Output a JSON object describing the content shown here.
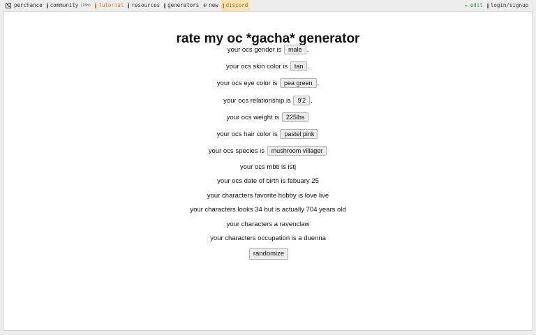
{
  "nav": {
    "brand": "perchance",
    "community": "community",
    "community_badge": "(10h)",
    "tutorial": "tutorial",
    "resources": "resources",
    "generators": "generators",
    "new": "new",
    "discord": "discord",
    "edit": "edit",
    "login": "login/signup"
  },
  "page": {
    "title": "rate my oc *gacha* generator",
    "rows": [
      {
        "prefix": "your ocs gender is",
        "value": "male",
        "suffix": "."
      },
      {
        "prefix": "your ocs skin color is",
        "value": "tan",
        "suffix": "."
      },
      {
        "prefix": "your ocs eye color is",
        "value": "pea green",
        "suffix": "."
      },
      {
        "prefix": "your ocs relationship is",
        "value": "9'2",
        "suffix": "."
      },
      {
        "prefix": "your ocs weight is",
        "value": "225lbs",
        "suffix": ""
      },
      {
        "prefix": "your ocs hair color is",
        "value": "pastel pink",
        "suffix": ""
      },
      {
        "prefix": "your ocs species is",
        "value": "mushroom villager",
        "suffix": ""
      }
    ],
    "lines": [
      "your ocs mbti is istj",
      "your ocs date of birth is febuary 25",
      "your characters favorite hobby is love live",
      "your characters looks 34 but is actually 704 years old",
      "your characters a ravenclaw",
      "your characters occupation is a duenna"
    ],
    "randomize_label": "randomize"
  },
  "colors": {
    "accent_orange": "#e07a1f",
    "edit_green": "#3a9a3a",
    "discord_bg": "#fde3b3"
  }
}
